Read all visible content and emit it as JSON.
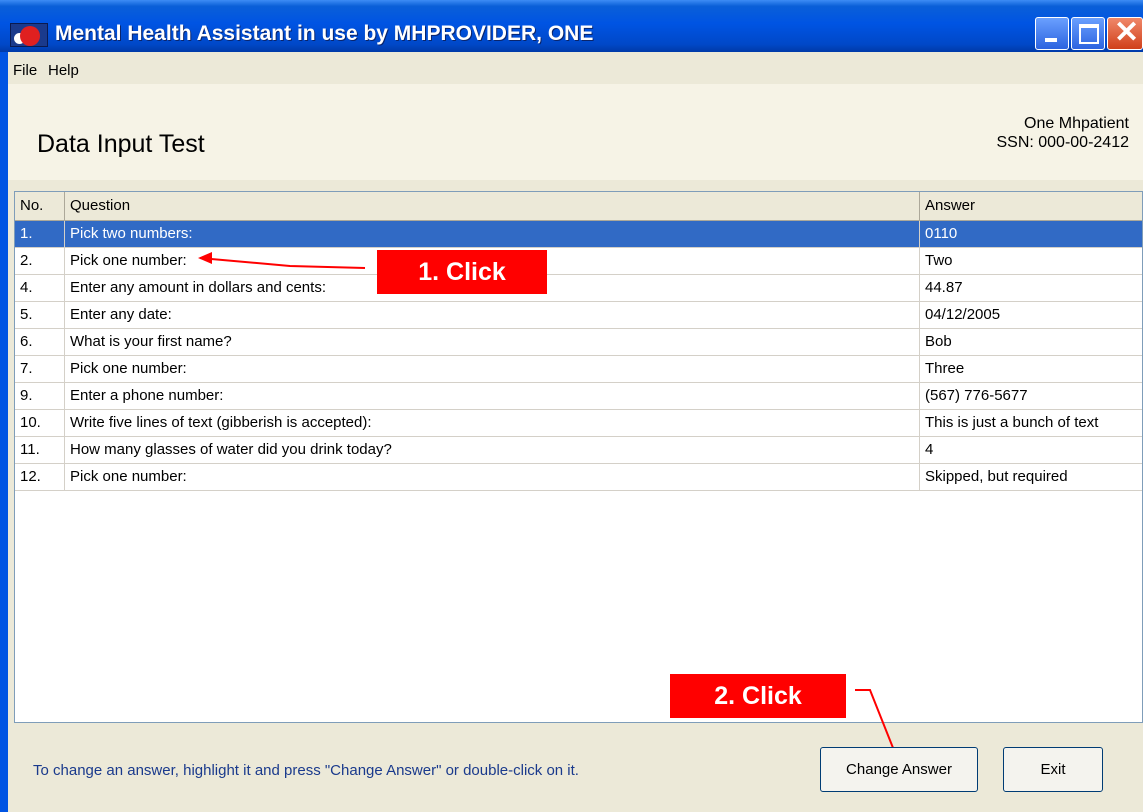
{
  "window": {
    "title": "Mental Health Assistant in use by MHPROVIDER, ONE"
  },
  "menu": {
    "items": [
      "File",
      "Help"
    ]
  },
  "header": {
    "title": "Data Input Test",
    "patient_name": "One Mhpatient",
    "patient_ssn": "SSN: 000-00-2412"
  },
  "grid": {
    "columns": [
      "No.",
      "Question",
      "Answer"
    ],
    "rows": [
      {
        "no": "1.",
        "question": "Pick two numbers:",
        "answer": "0110"
      },
      {
        "no": "2.",
        "question": "Pick one number:",
        "answer": "Two"
      },
      {
        "no": "4.",
        "question": "Enter any amount in dollars and cents:",
        "answer": "44.87"
      },
      {
        "no": "5.",
        "question": "Enter any date:",
        "answer": "04/12/2005"
      },
      {
        "no": "6.",
        "question": "What is your first name?",
        "answer": "Bob"
      },
      {
        "no": "7.",
        "question": "Pick one number:",
        "answer": "Three"
      },
      {
        "no": "9.",
        "question": "Enter a phone number:",
        "answer": "(567) 776-5677"
      },
      {
        "no": "10.",
        "question": "Write five lines of text (gibberish is accepted):",
        "answer": "This is just a bunch of text"
      },
      {
        "no": "11.",
        "question": "How many glasses of water did you drink today?",
        "answer": "4"
      },
      {
        "no": "12.",
        "question": "Pick one number:",
        "answer": "Skipped, but required"
      }
    ],
    "selected_row": 0
  },
  "annotations": {
    "callout1": "1. Click",
    "callout2": "2. Click"
  },
  "footer": {
    "hint": "To change an answer, highlight it and press \"Change Answer\" or double-click on it.",
    "change_answer_label": "Change Answer",
    "exit_label": "Exit"
  },
  "colors": {
    "selection": "#316ac5",
    "callout": "#ff0000",
    "titlebar": "#0054e3"
  }
}
